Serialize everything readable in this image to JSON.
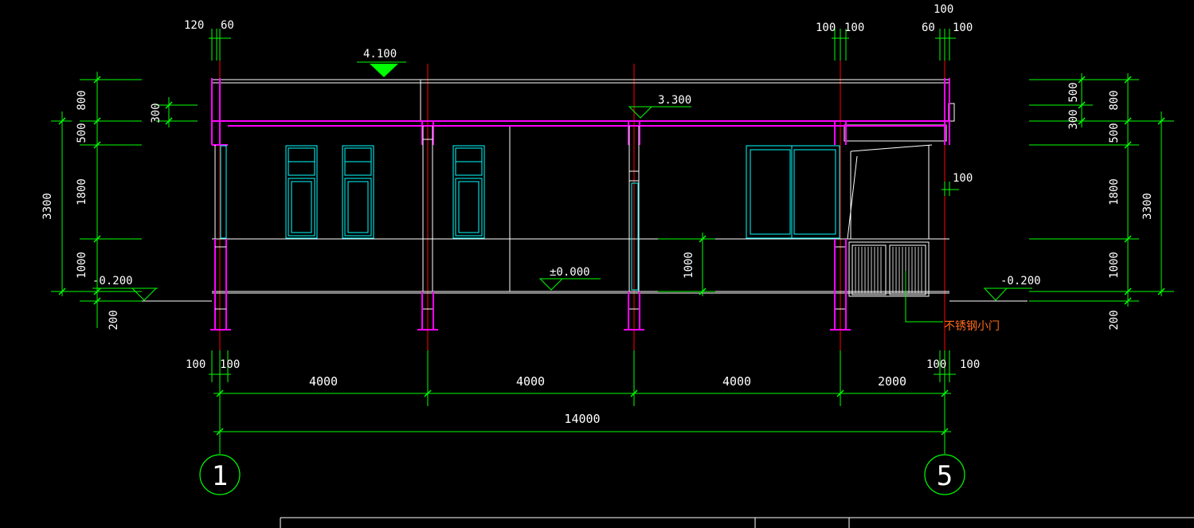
{
  "colors": {
    "background": "#000000",
    "dimension": "#00ff00",
    "dimension_text": "#ffffff",
    "axis_line": "#ff0000",
    "wall": "#ff00ff",
    "window": "#00ffff",
    "outline": "#ffffff",
    "label_orange": "#ff6a1a",
    "level_marker": "#00ff00"
  },
  "top_dims": {
    "left_a": "120",
    "left_b": "60",
    "right_a": "100",
    "right_b": "100",
    "right_top": "100",
    "right_c": "60",
    "right_d": "100"
  },
  "levels": {
    "roof": "4.100",
    "ceiling": "3.300",
    "floor": "±0.000",
    "ground_left": "-0.200",
    "ground_right": "-0.200"
  },
  "left_dims": {
    "d800": "800",
    "d300": "300",
    "d500": "500",
    "d1800": "1800",
    "d1000": "1000",
    "d3300": "3300",
    "d200": "200"
  },
  "right_dims": {
    "d500": "500",
    "d800": "800",
    "d300": "300",
    "d500b": "500",
    "d1800": "1800",
    "d3300": "3300",
    "d1000": "1000",
    "d200": "200",
    "d100": "100"
  },
  "inner_dims": {
    "sill": "1000"
  },
  "bottom_dims": {
    "left_a": "100",
    "left_b": "100",
    "right_a": "100",
    "right_b": "100",
    "bay1": "4000",
    "bay2": "4000",
    "bay3": "4000",
    "bay4": "2000",
    "total": "14000"
  },
  "axes": {
    "left": "1",
    "right": "5"
  },
  "labels": {
    "door": "不锈钢小门"
  }
}
